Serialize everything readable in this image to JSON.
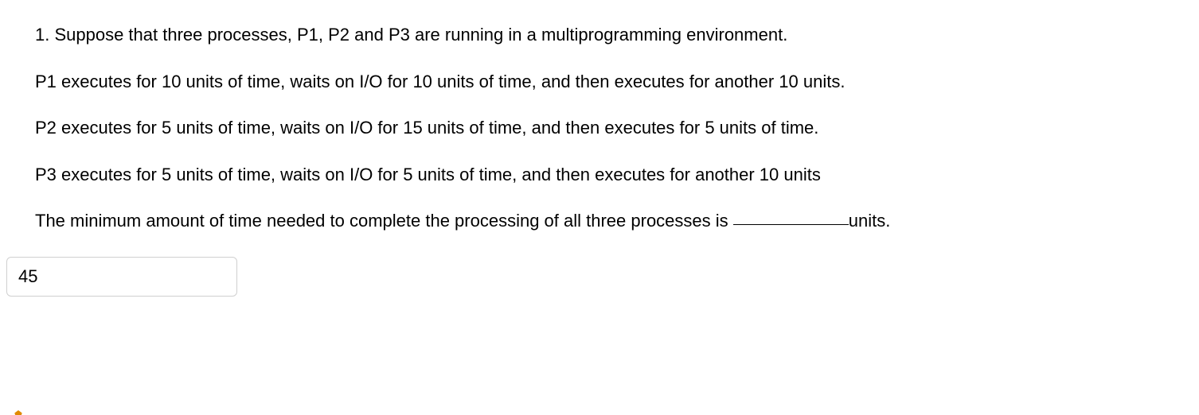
{
  "question": {
    "line1": "1. Suppose that three processes, P1, P2 and P3 are running in a multiprogramming environment.",
    "line2": " P1 executes for 10 units of time, waits on I/O for 10 units of time, and then executes for another 10 units.",
    "line3": "P2 executes for 5 units of time, waits on I/O for 15 units of time, and then executes for 5 units of time.",
    "line4": "P3 executes for 5 units of time, waits on I/O for 5 units of time, and then executes for another 10 units",
    "line5_prefix": "The minimum amount of time needed to complete the processing of all three processes is ",
    "line5_suffix": "units."
  },
  "answer_value": "45"
}
